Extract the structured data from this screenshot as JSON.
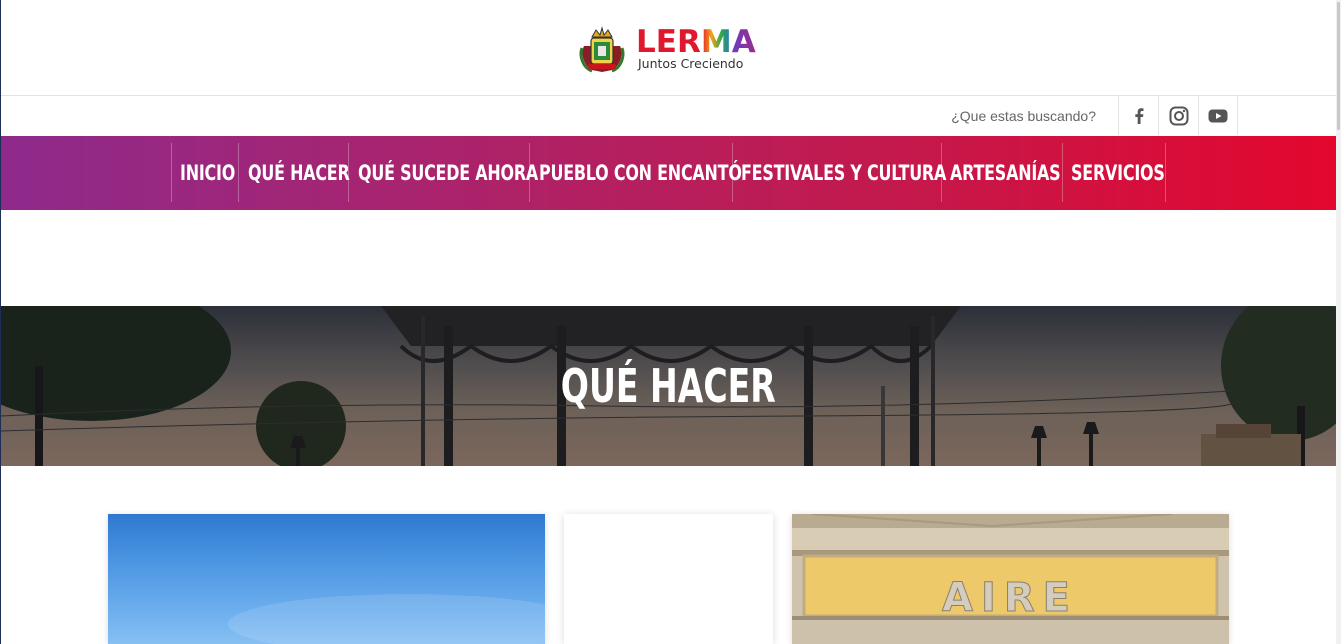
{
  "brand": {
    "name": "LERMA",
    "tagline": "Juntos Creciendo",
    "letter_colors": [
      "#e0182d",
      "#e0182d",
      "#e0182d",
      "#8b2a8c",
      "#8b2a8c"
    ]
  },
  "header": {
    "search_placeholder": "¿Que estas buscando?",
    "social": [
      {
        "icon": "facebook-icon",
        "label": "f"
      },
      {
        "icon": "instagram-icon"
      },
      {
        "icon": "youtube-icon"
      }
    ]
  },
  "nav": {
    "items": [
      {
        "label": "INICIO"
      },
      {
        "label": "QUÉ HACER"
      },
      {
        "label": "QUÉ SUCEDE AHORA"
      },
      {
        "label": "PUEBLO CON ENCANTÓ"
      },
      {
        "label": "FESTIVALES Y CULTURA"
      },
      {
        "label": "ARTESANÍAS"
      },
      {
        "label": "SERVICIOS"
      }
    ],
    "gradient": [
      "#8e2a8c",
      "#e3072e"
    ]
  },
  "hero": {
    "title": "QUÉ HACER"
  },
  "cards": [
    {
      "image": "blue-sky-photo"
    },
    {
      "image": "blank"
    },
    {
      "image": "stone-plaque-photo",
      "plaque_text": "AIRE"
    }
  ],
  "colors": {
    "nav_start": "#8e2a8c",
    "nav_end": "#e3072e",
    "text_muted": "#666666"
  }
}
